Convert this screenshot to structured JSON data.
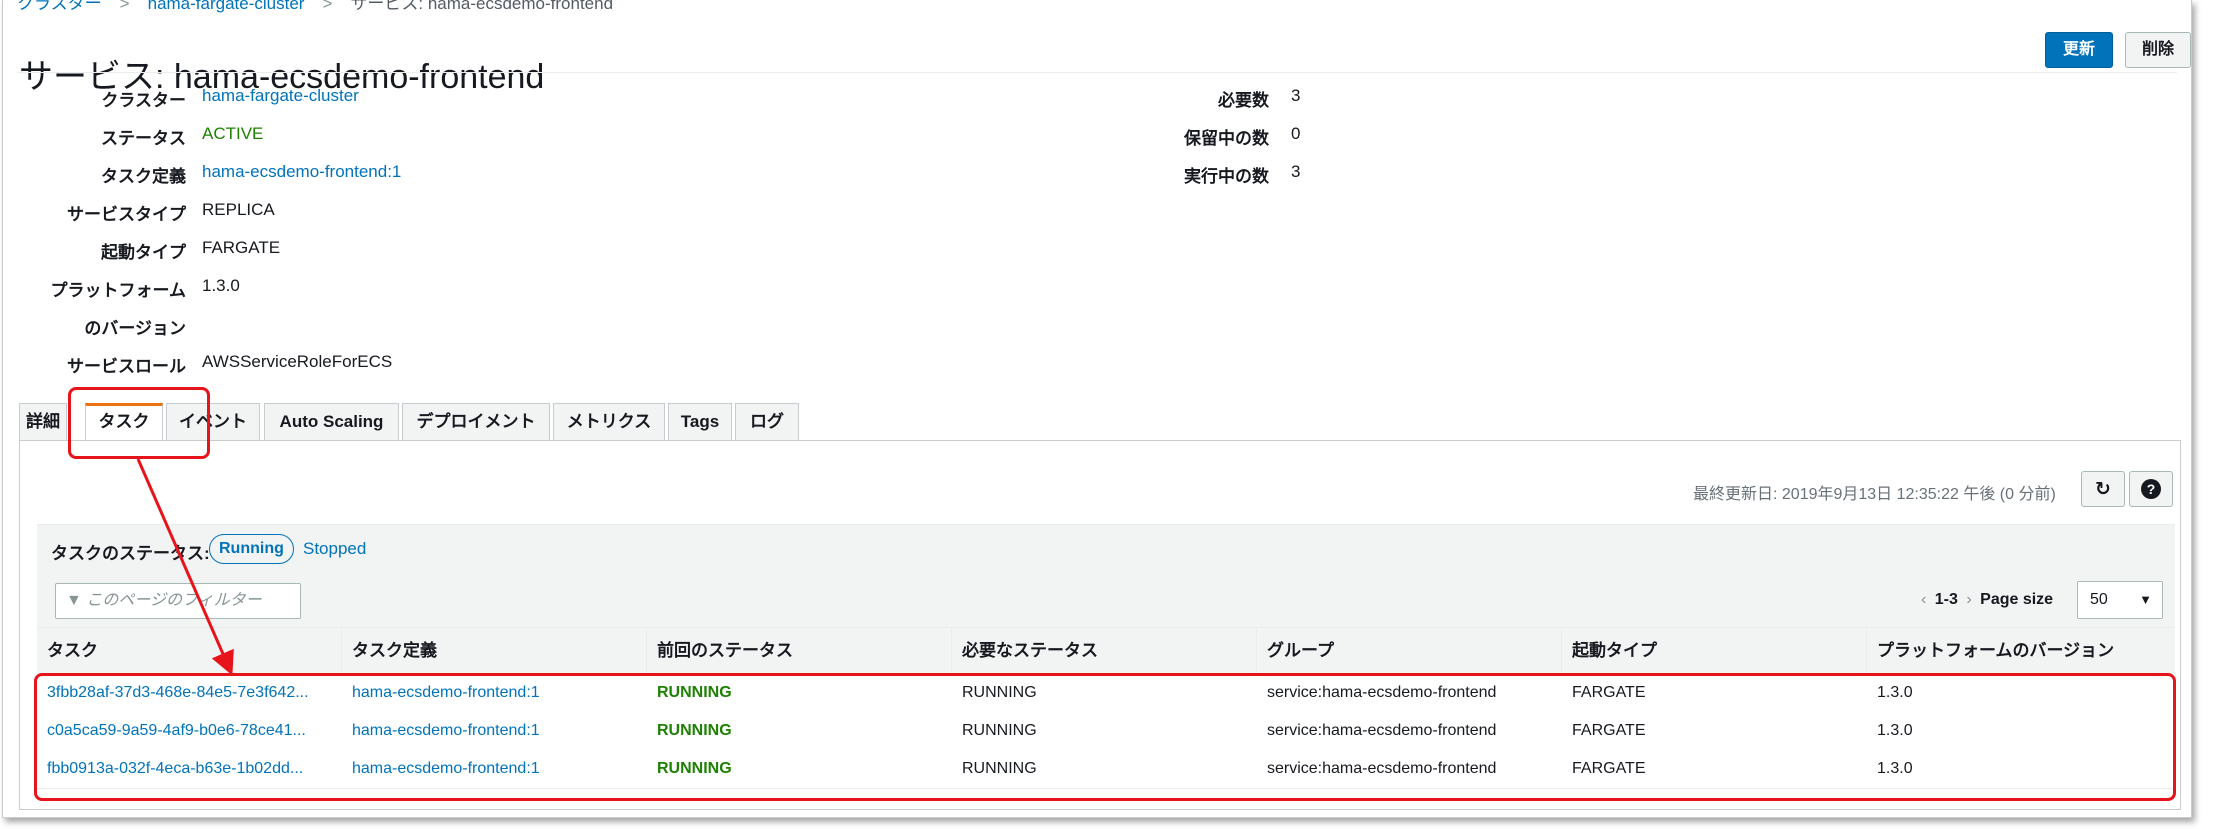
{
  "breadcrumb": {
    "items": [
      "クラスター",
      "hama-fargate-cluster",
      "サービス: hama-ecsdemo-frontend"
    ]
  },
  "header": {
    "title": "サービス: hama-ecsdemo-frontend",
    "update_label": "更新",
    "delete_label": "削除"
  },
  "details_left": [
    {
      "key": "クラスター",
      "value": "hama-fargate-cluster"
    },
    {
      "key": "ステータス",
      "value": "ACTIVE"
    },
    {
      "key": "タスク定義",
      "value": "hama-ecsdemo-frontend:1"
    },
    {
      "key": "サービスタイプ",
      "value": "REPLICA"
    },
    {
      "key": "起動タイプ",
      "value": "FARGATE"
    },
    {
      "key": "プラットフォーム",
      "value": "1.3.0"
    },
    {
      "key": "のバージョン",
      "value": ""
    },
    {
      "key": "サービスロール",
      "value": "AWSServiceRoleForECS"
    }
  ],
  "details_right": [
    {
      "key": "必要数",
      "value": "3"
    },
    {
      "key": "保留中の数",
      "value": "0"
    },
    {
      "key": "実行中の数",
      "value": "3"
    }
  ],
  "tabs": [
    "詳細",
    "タスク",
    "イベント",
    "Auto Scaling",
    "デプロイメント",
    "メトリクス",
    "Tags",
    "ログ"
  ],
  "active_tab": "タスク",
  "panel": {
    "last_updated": "最終更新日: 2019年9月13日 12:35:22 午後 (0 分前)",
    "refresh_icon": "refresh-icon",
    "help_icon": "help-icon",
    "status_label": "タスクのステータス:",
    "status_running": "Running",
    "status_stopped": "Stopped",
    "filter_placeholder": "このページのフィルター",
    "pager_range": "1-3",
    "page_size_label": "Page size",
    "page_size_value": "50"
  },
  "table": {
    "columns": [
      "タスク",
      "タスク定義",
      "前回のステータス",
      "必要なステータス",
      "グループ",
      "起動タイプ",
      "プラットフォームのバージョン"
    ],
    "rows": [
      [
        "3fbb28af-37d3-468e-84e5-7e3f642...",
        "hama-ecsdemo-frontend:1",
        "RUNNING",
        "RUNNING",
        "service:hama-ecsdemo-frontend",
        "FARGATE",
        "1.3.0"
      ],
      [
        "c0a5ca59-9a59-4af9-b0e6-78ce41...",
        "hama-ecsdemo-frontend:1",
        "RUNNING",
        "RUNNING",
        "service:hama-ecsdemo-frontend",
        "FARGATE",
        "1.3.0"
      ],
      [
        "fbb0913a-032f-4eca-b63e-1b02dd...",
        "hama-ecsdemo-frontend:1",
        "RUNNING",
        "RUNNING",
        "service:hama-ecsdemo-frontend",
        "FARGATE",
        "1.3.0"
      ]
    ]
  },
  "colors": {
    "link": "#0073bb",
    "running": "#1d8102",
    "annotation": "#e8141b",
    "tab_accent": "#ec7211"
  }
}
